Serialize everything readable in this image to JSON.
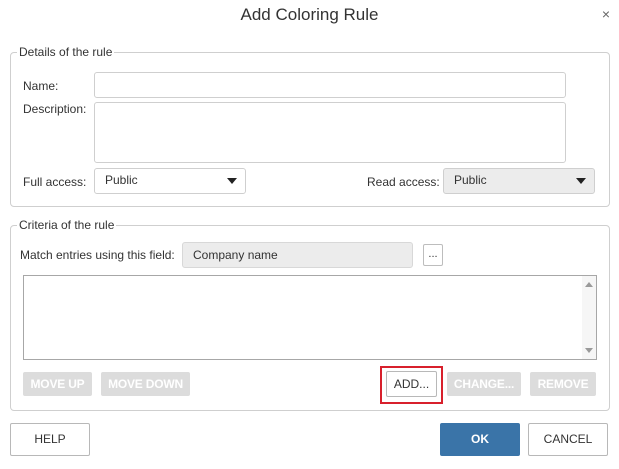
{
  "dialog": {
    "title": "Add Coloring Rule",
    "close_icon": "×"
  },
  "details": {
    "legend": "Details of the rule",
    "name_label": "Name:",
    "name_value": "",
    "description_label": "Description:",
    "description_value": "",
    "full_access_label": "Full access:",
    "full_access_value": "Public",
    "read_access_label": "Read access:",
    "read_access_value": "Public"
  },
  "criteria": {
    "legend": "Criteria of the rule",
    "match_label": "Match entries using this field:",
    "match_field_value": "Company name",
    "ellipsis_label": "...",
    "buttons": {
      "move_up": "MOVE UP",
      "move_down": "MOVE DOWN",
      "add": "ADD...",
      "change": "CHANGE...",
      "remove": "REMOVE"
    }
  },
  "footer": {
    "help": "HELP",
    "ok": "OK",
    "cancel": "CANCEL"
  },
  "colors": {
    "primary": "#3a74a8",
    "highlight": "#d8202c",
    "disabled": "#dcdcdc"
  }
}
